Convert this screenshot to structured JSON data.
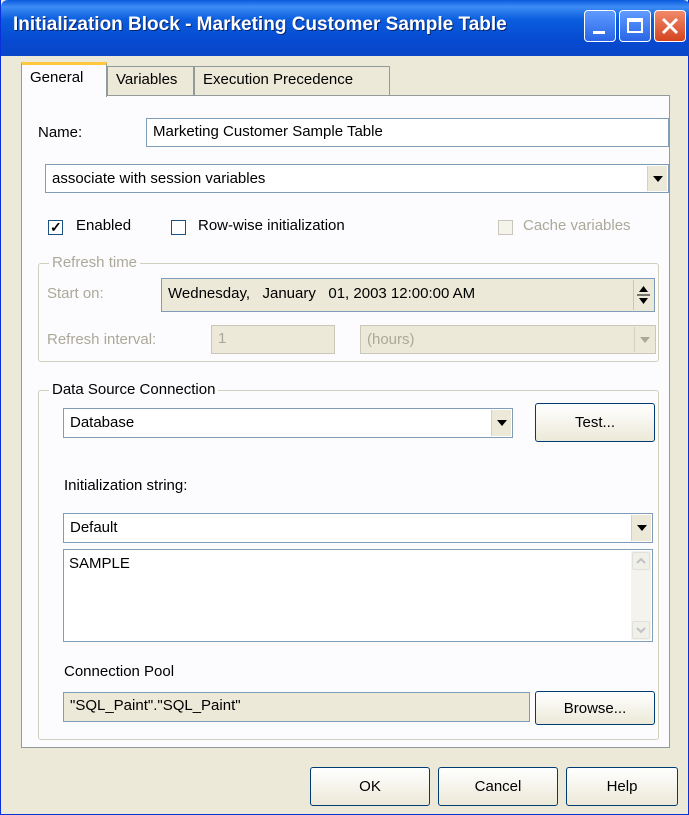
{
  "window": {
    "title": "Initialization Block - Marketing Customer Sample Table"
  },
  "tabs": [
    {
      "label": "General",
      "active": true
    },
    {
      "label": "Variables",
      "active": false
    },
    {
      "label": "Execution Precedence",
      "active": false
    }
  ],
  "general": {
    "name_label": "Name:",
    "name_value": "Marketing Customer Sample Table",
    "association": "associate with session variables",
    "enabled_label": "Enabled",
    "enabled_checked": true,
    "rowwise_label": "Row-wise initialization",
    "rowwise_checked": false,
    "cache_label": "Cache variables",
    "cache_checked": false,
    "refresh": {
      "legend": "Refresh time",
      "start_label": "Start on:",
      "start_value": "Wednesday,   January   01, 2003 12:00:00 AM",
      "interval_label": "Refresh interval:",
      "interval_value": "1",
      "interval_unit": "(hours)"
    },
    "datasource": {
      "legend": "Data Source Connection",
      "type_value": "Database",
      "test_label": "Test...",
      "init_string_label": "Initialization string:",
      "init_string_mode": "Default",
      "init_string_text": "SAMPLE",
      "pool_label": "Connection Pool",
      "pool_value": "\"SQL_Paint\".\"SQL_Paint\"",
      "browse_label": "Browse..."
    }
  },
  "footer": {
    "ok_label": "OK",
    "cancel_label": "Cancel",
    "help_label": "Help"
  }
}
